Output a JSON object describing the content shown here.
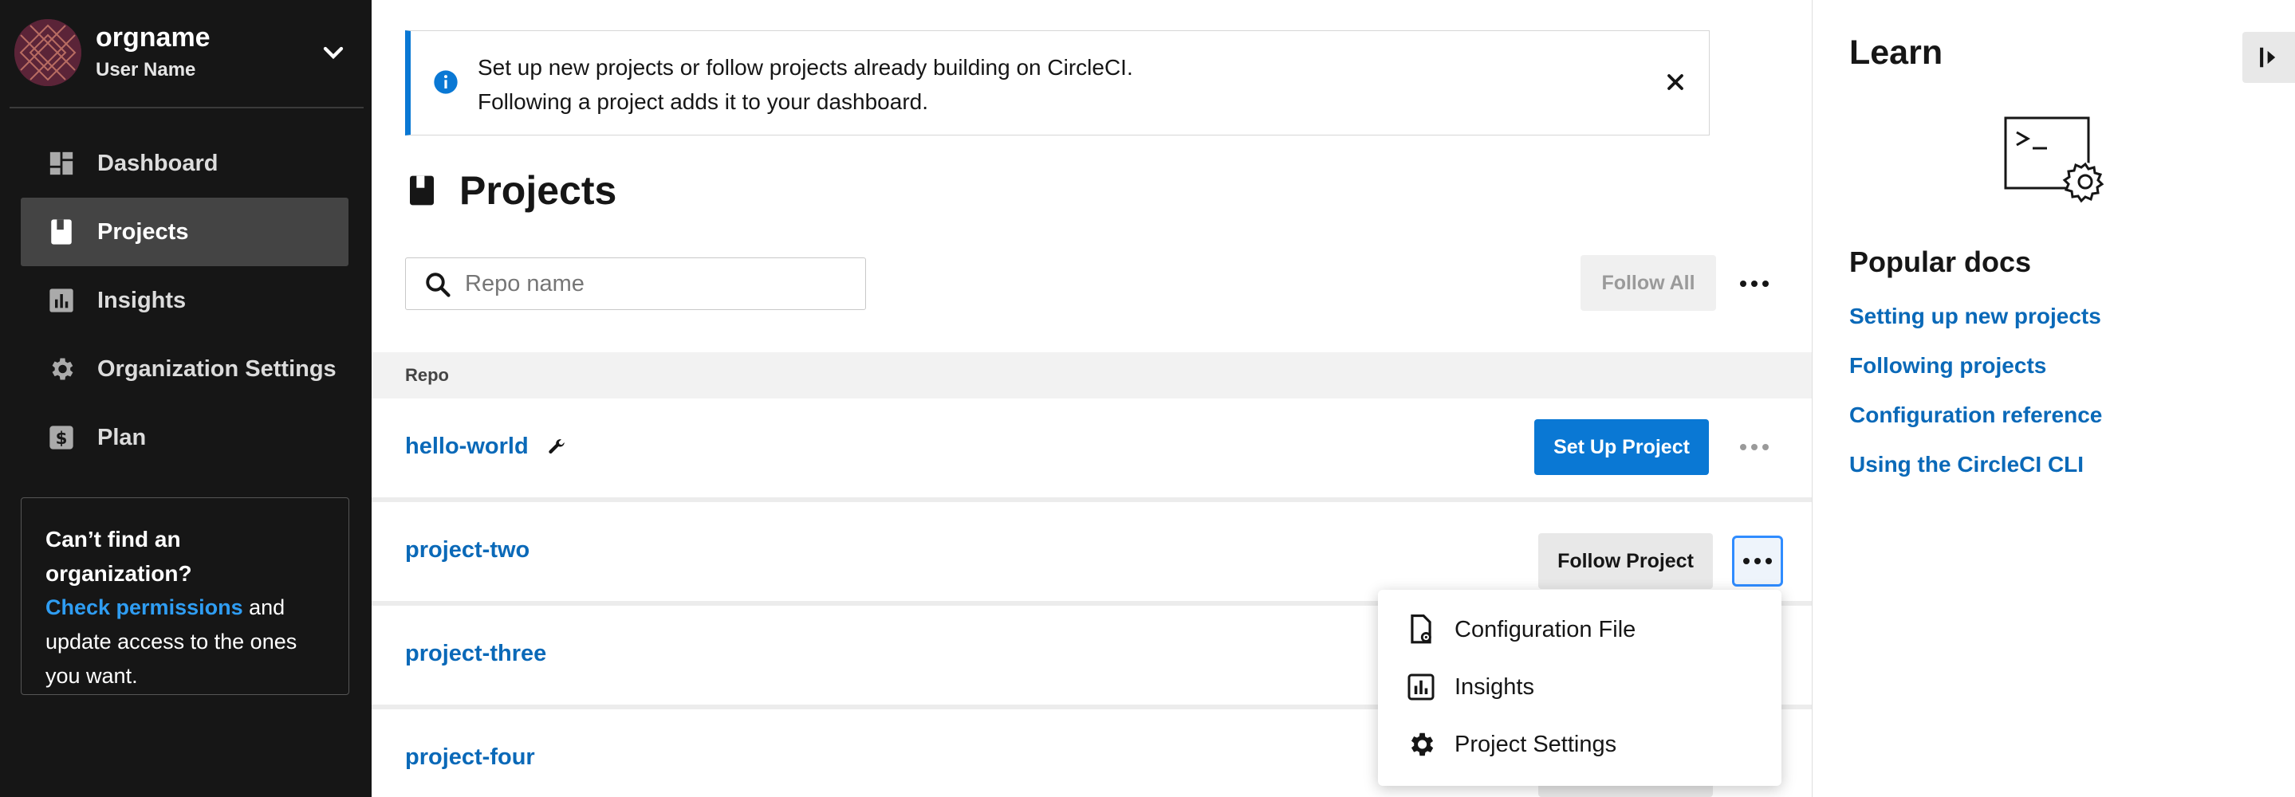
{
  "sidebar": {
    "org_name": "orgname",
    "user_name": "User Name",
    "items": [
      {
        "label": "Dashboard",
        "icon": "dashboard-icon",
        "active": false
      },
      {
        "label": "Projects",
        "icon": "book-icon",
        "active": true
      },
      {
        "label": "Insights",
        "icon": "insights-icon",
        "active": false
      },
      {
        "label": "Organization Settings",
        "icon": "gear-icon",
        "active": false
      },
      {
        "label": "Plan",
        "icon": "dollar-icon",
        "active": false
      }
    ],
    "help": {
      "title": "Can’t find an organization?",
      "link": "Check permissions",
      "text": " and update access to the ones you want."
    }
  },
  "banner": {
    "line1": "Set up new projects or follow projects already building on CircleCI.",
    "line2": "Following a project adds it to your dashboard."
  },
  "main": {
    "title": "Projects",
    "search_placeholder": "Repo name",
    "follow_all_label": "Follow All",
    "column_repo": "Repo",
    "rows": [
      {
        "name": "hello-world",
        "action": "Set Up Project"
      },
      {
        "name": "project-two",
        "action": "Follow Project"
      },
      {
        "name": "project-three",
        "action": ""
      },
      {
        "name": "project-four",
        "action": ""
      }
    ]
  },
  "menu": {
    "items": [
      {
        "label": "Configuration File",
        "icon": "config-file-icon"
      },
      {
        "label": "Insights",
        "icon": "insights-icon"
      },
      {
        "label": "Project Settings",
        "icon": "gear-icon"
      }
    ]
  },
  "learn": {
    "title": "Learn",
    "popular_title": "Popular docs",
    "docs": [
      "Setting up new projects",
      "Following projects",
      "Configuration reference",
      "Using the CircleCI CLI"
    ]
  },
  "colors": {
    "sidebar_bg": "#161616",
    "accent": "#0a78d4",
    "link": "#0a69b8"
  }
}
